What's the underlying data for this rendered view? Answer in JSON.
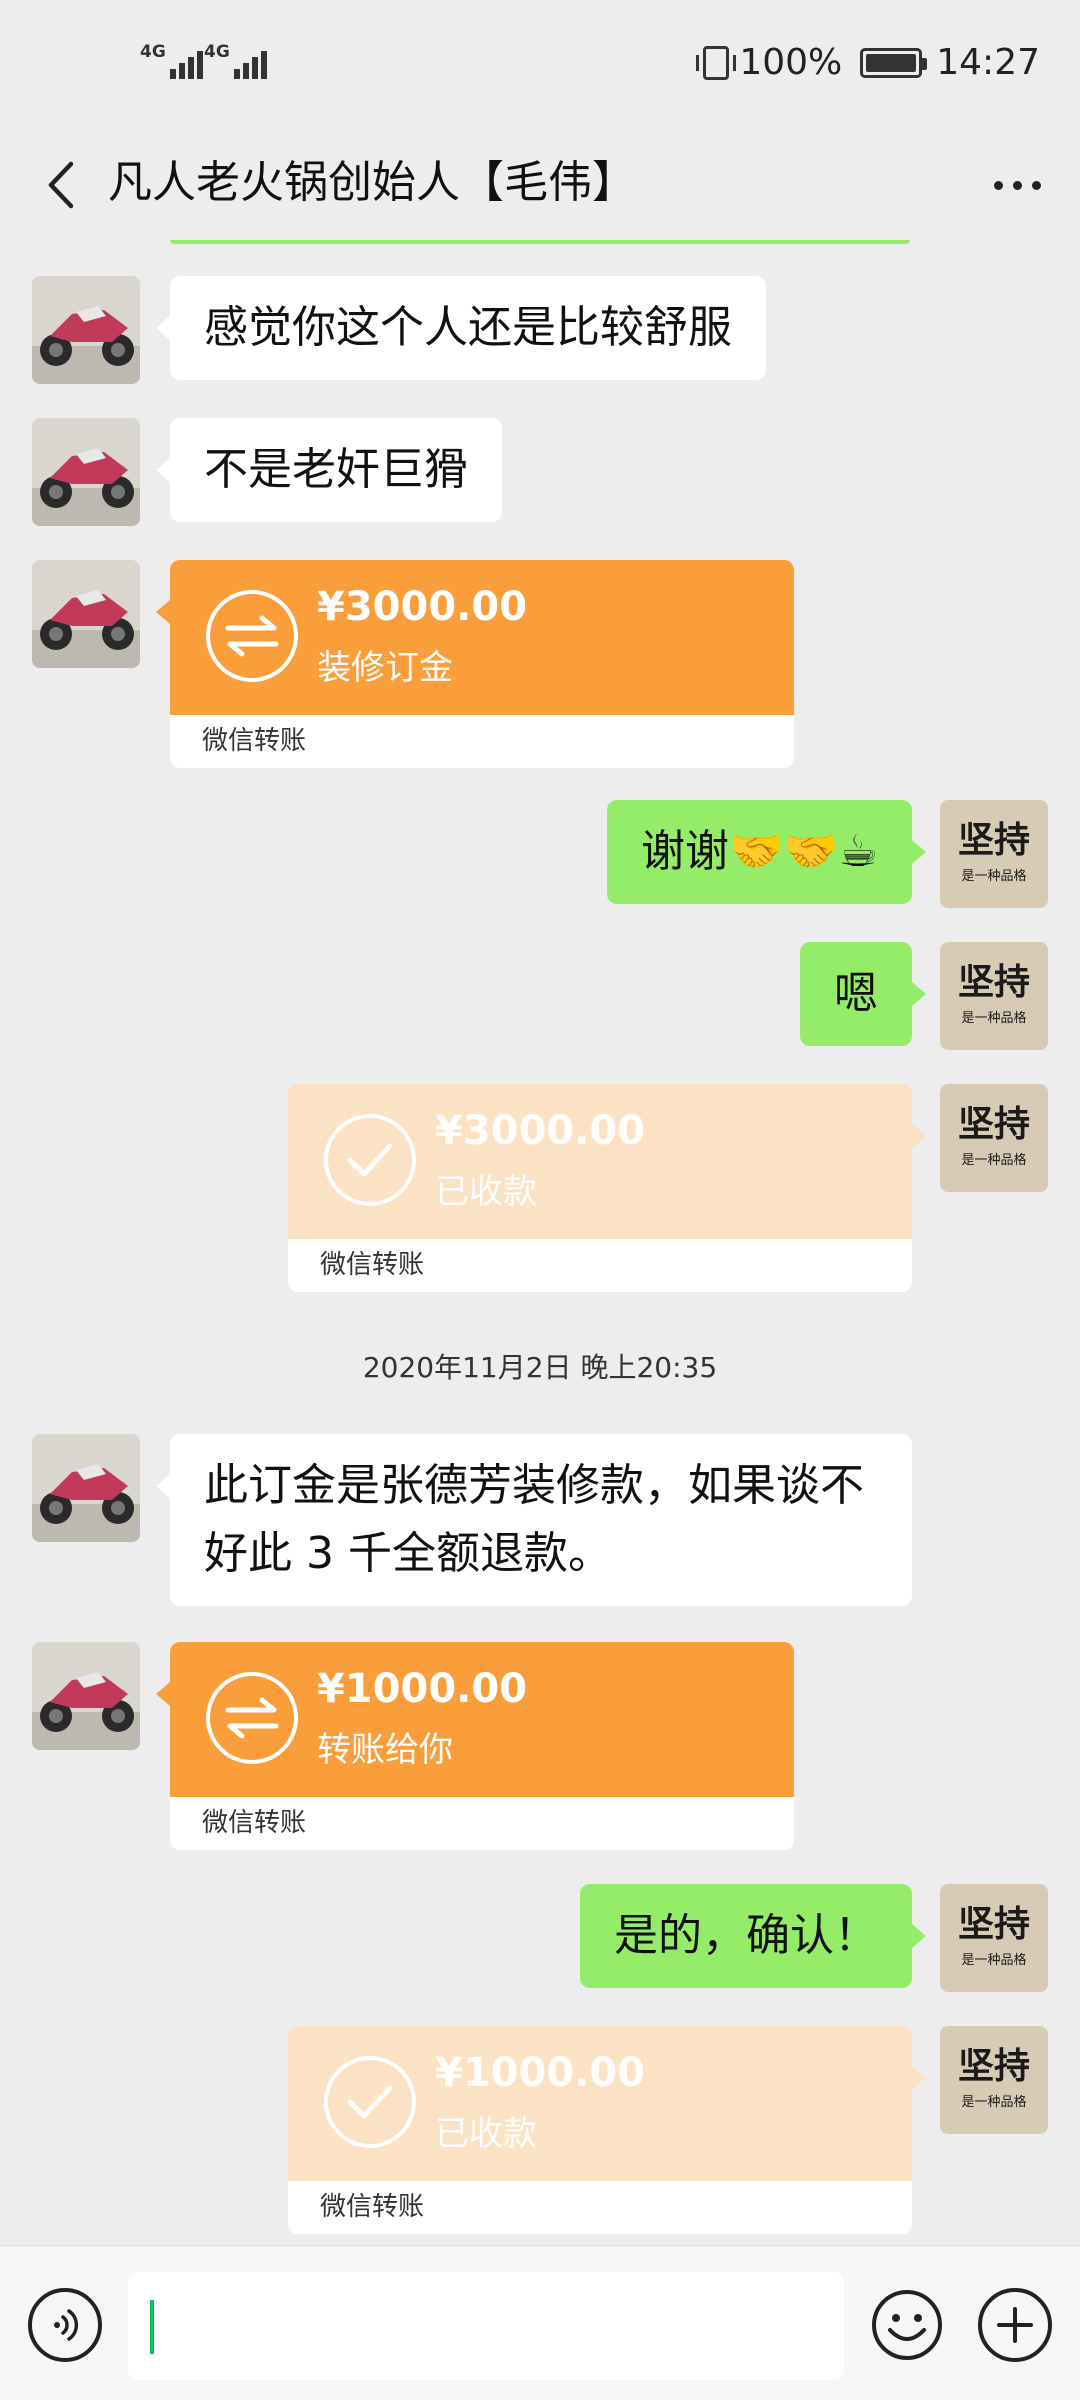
{
  "status_bar": {
    "network_1": "4G",
    "network_2": "4G",
    "battery_text": "100%",
    "time": "14:27"
  },
  "header": {
    "title": "凡人老火锅创始人【毛伟】"
  },
  "messages": [
    {
      "side": "left",
      "type": "text",
      "text": "感觉你这个人还是比较舒服"
    },
    {
      "side": "left",
      "type": "text",
      "text": "不是老奸巨猾"
    },
    {
      "side": "left",
      "type": "transfer",
      "amount": "¥3000.00",
      "note": "装修订金",
      "footer": "微信转账"
    },
    {
      "side": "right",
      "type": "text",
      "text": "谢谢🤝🤝☕"
    },
    {
      "side": "right",
      "type": "text",
      "text": "嗯"
    },
    {
      "side": "right",
      "type": "transfer_received",
      "amount": "¥3000.00",
      "note": "已收款",
      "footer": "微信转账"
    },
    {
      "type": "timestamp",
      "text": "2020年11月2日 晚上20:35"
    },
    {
      "side": "left",
      "type": "text",
      "text": "此订金是张德芳装修款，如果谈不好此 3 千全额退款。"
    },
    {
      "side": "left",
      "type": "transfer",
      "amount": "¥1000.00",
      "note": "转账给你",
      "footer": "微信转账"
    },
    {
      "side": "right",
      "type": "text",
      "text": "是的，确认！"
    },
    {
      "side": "right",
      "type": "transfer_received",
      "amount": "¥1000.00",
      "note": "已收款",
      "footer": "微信转账"
    }
  ],
  "self_avatar": {
    "line1": "坚持",
    "line2": "是一种品格"
  },
  "input_bar": {
    "placeholder": ""
  },
  "colors": {
    "bubble_green": "#95ec69",
    "transfer_orange": "#fa9e3b",
    "transfer_received": "#fbe2c4",
    "background": "#ededed"
  }
}
